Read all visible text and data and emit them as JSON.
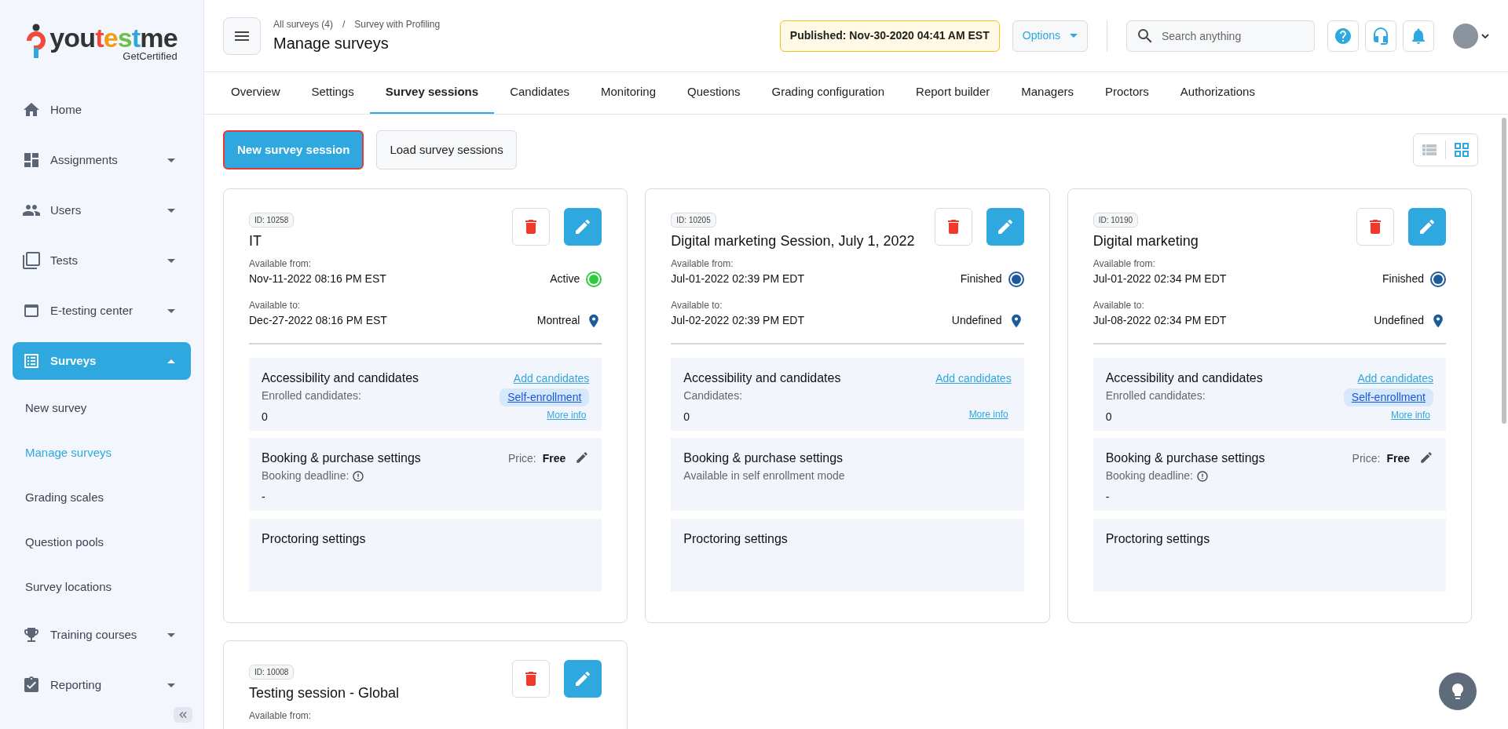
{
  "sidebar": {
    "logo": {
      "name": "youtestme",
      "tagline": "GetCertified"
    },
    "items": [
      {
        "label": "Home",
        "expandable": false,
        "expanded": false,
        "selected": false
      },
      {
        "label": "Assignments",
        "expandable": true,
        "expanded": false,
        "selected": false
      },
      {
        "label": "Users",
        "expandable": true,
        "expanded": false,
        "selected": false
      },
      {
        "label": "Tests",
        "expandable": true,
        "expanded": false,
        "selected": false
      },
      {
        "label": "E-testing center",
        "expandable": true,
        "expanded": false,
        "selected": false
      },
      {
        "label": "Surveys",
        "expandable": true,
        "expanded": true,
        "selected": true,
        "children": [
          {
            "label": "New survey",
            "selected": false
          },
          {
            "label": "Manage surveys",
            "selected": true
          },
          {
            "label": "Grading scales",
            "selected": false
          },
          {
            "label": "Question pools",
            "selected": false
          },
          {
            "label": "Survey locations",
            "selected": false
          }
        ]
      },
      {
        "label": "Training courses",
        "expandable": true,
        "expanded": false,
        "selected": false
      },
      {
        "label": "Reporting",
        "expandable": true,
        "expanded": false,
        "selected": false
      }
    ]
  },
  "header": {
    "breadcrumb": [
      "All surveys (4)",
      "Survey with Profiling"
    ],
    "breadcrumb_separator": "/",
    "title": "Manage surveys",
    "published": "Published: Nov-30-2020 04:41 AM EST",
    "options": "Options",
    "search": {
      "placeholder": "Search anything"
    }
  },
  "tabs": [
    {
      "label": "Overview",
      "selected": false
    },
    {
      "label": "Settings",
      "selected": false
    },
    {
      "label": "Survey sessions",
      "selected": true
    },
    {
      "label": "Candidates",
      "selected": false
    },
    {
      "label": "Monitoring",
      "selected": false
    },
    {
      "label": "Questions",
      "selected": false
    },
    {
      "label": "Grading configuration",
      "selected": false
    },
    {
      "label": "Report builder",
      "selected": false
    },
    {
      "label": "Managers",
      "selected": false
    },
    {
      "label": "Proctors",
      "selected": false
    },
    {
      "label": "Authorizations",
      "selected": false
    }
  ],
  "toolbar": {
    "buttons": [
      {
        "label": "New survey session",
        "kind": "primary"
      },
      {
        "label": "Load survey sessions",
        "kind": "secondary"
      }
    ],
    "view_toggle": [
      {
        "kind": "list",
        "selected": false
      },
      {
        "kind": "grid",
        "selected": true
      }
    ]
  },
  "sessions": [
    {
      "id": "ID: 10258",
      "title": "IT",
      "from_label": "Available from:",
      "from": "Nov-11-2022 08:16 PM EST",
      "status": "Active",
      "color": "#2ecc40",
      "to_label": "Available to:",
      "to": "Dec-27-2022 08:16 PM EST",
      "location": "Montreal",
      "accessibility": {
        "title": "Accessibility and candidates",
        "label": "Enrolled candidates:",
        "count": "0",
        "add_link": "Add candidates",
        "self_enrollment": "Self-enrollment",
        "more_info": "More info"
      },
      "booking": {
        "title": "Booking & purchase settings",
        "price_label": "Price:",
        "price": "Free",
        "deadline_label": "Booking deadline:",
        "deadline": "-"
      },
      "proctoring": {
        "title": "Proctoring settings"
      }
    },
    {
      "id": "ID: 10205",
      "title": "Digital marketing Session, July 1, 2022",
      "from_label": "Available from:",
      "from": "Jul-01-2022 02:39 PM EDT",
      "status": "Finished",
      "color": "#1d5a9b",
      "to_label": "Available to:",
      "to": "Jul-02-2022 02:39 PM EDT",
      "location": "Undefined",
      "accessibility": {
        "title": "Accessibility and candidates",
        "label": "Candidates:",
        "count": "0",
        "add_link": "Add candidates",
        "more_info": "More info"
      },
      "booking": {
        "title": "Booking & purchase settings",
        "note": "Available in self enrollment mode"
      },
      "proctoring": {
        "title": "Proctoring settings"
      }
    },
    {
      "id": "ID: 10190",
      "title": "Digital marketing",
      "from_label": "Available from:",
      "from": "Jul-01-2022 02:34 PM EDT",
      "status": "Finished",
      "color": "#1d5a9b",
      "to_label": "Available to:",
      "to": "Jul-08-2022 02:34 PM EDT",
      "location": "Undefined",
      "accessibility": {
        "title": "Accessibility and candidates",
        "label": "Enrolled candidates:",
        "count": "0",
        "add_link": "Add candidates",
        "self_enrollment": "Self-enrollment",
        "more_info": "More info"
      },
      "booking": {
        "title": "Booking & purchase settings",
        "price_label": "Price:",
        "price": "Free",
        "deadline_label": "Booking deadline:",
        "deadline": "-"
      },
      "proctoring": {
        "title": "Proctoring settings"
      }
    },
    {
      "id": "ID: 10008",
      "title": "Testing session - Global",
      "from_label": "Available from:"
    }
  ]
}
